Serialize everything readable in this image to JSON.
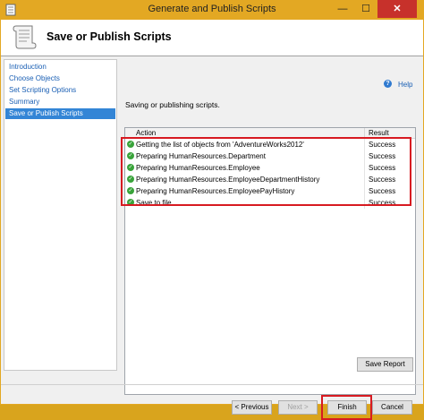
{
  "window": {
    "title": "Generate and Publish Scripts",
    "minimize": "—",
    "maximize": "☐",
    "close": "✕"
  },
  "header": {
    "title": "Save or Publish Scripts"
  },
  "nav": {
    "items": [
      {
        "label": "Introduction"
      },
      {
        "label": "Choose Objects"
      },
      {
        "label": "Set Scripting Options"
      },
      {
        "label": "Summary"
      },
      {
        "label": "Save or Publish Scripts"
      }
    ],
    "selected_index": 4
  },
  "help": {
    "label": "Help",
    "icon_glyph": "?"
  },
  "status": "Saving or publishing scripts.",
  "grid": {
    "columns": [
      "Action",
      "Result"
    ],
    "rows": [
      {
        "action": "Getting the list of objects from 'AdventureWorks2012'",
        "result": "Success"
      },
      {
        "action": "Preparing HumanResources.Department",
        "result": "Success"
      },
      {
        "action": "Preparing HumanResources.Employee",
        "result": "Success"
      },
      {
        "action": "Preparing HumanResources.EmployeeDepartmentHistory",
        "result": "Success"
      },
      {
        "action": "Preparing HumanResources.EmployeePayHistory",
        "result": "Success"
      },
      {
        "action": "Save to file",
        "result": "Success"
      }
    ]
  },
  "buttons": {
    "save_report": "Save Report",
    "previous": "< Previous",
    "next": "Next >",
    "finish": "Finish",
    "cancel": "Cancel"
  },
  "colors": {
    "title_bar": "#e3a823",
    "highlight_box": "#d71a21",
    "selected_nav": "#3385d6",
    "success_icon": "#39a33a"
  }
}
